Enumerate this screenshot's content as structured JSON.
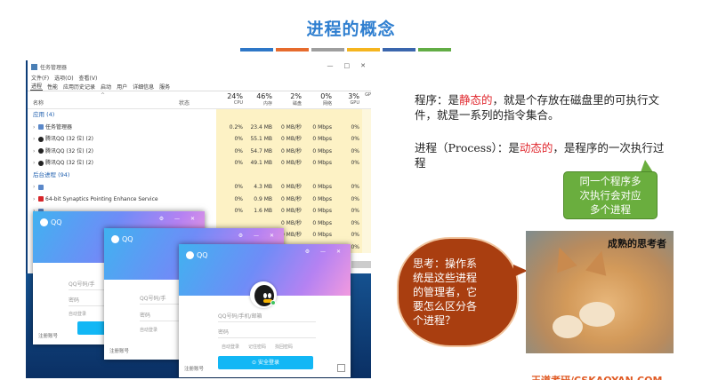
{
  "slide": {
    "title": "进程的概念",
    "colorbar": [
      "#2e77c7",
      "#e66b2d",
      "#9e9e9e",
      "#f5b51f",
      "#3a66ad",
      "#62ad45"
    ]
  },
  "task_manager": {
    "title": "任务管理器",
    "window_buttons": [
      "—",
      "□",
      "✕"
    ],
    "menu": [
      "文件(F)",
      "选项(O)",
      "查看(V)"
    ],
    "tabs": [
      "进程",
      "性能",
      "应用历史记录",
      "启动",
      "用户",
      "详细信息",
      "服务"
    ],
    "columns": {
      "name": "名称",
      "status": "状态",
      "metrics": [
        {
          "pct": "24%",
          "label": "CPU"
        },
        {
          "pct": "46%",
          "label": "内存"
        },
        {
          "pct": "2%",
          "label": "磁盘"
        },
        {
          "pct": "0%",
          "label": "网络"
        },
        {
          "pct": "3%",
          "label": "GPU"
        },
        {
          "pct": "",
          "label": "GP"
        }
      ]
    },
    "groups": {
      "apps": "应用 (4)",
      "background": "后台进程 (94)"
    },
    "app_rows": [
      {
        "name": "任务管理器",
        "icon": "task-manager-icon",
        "cpu": "0.2%",
        "mem": "23.4 MB",
        "disk": "0 MB/秒",
        "net": "0 Mbps",
        "gpu": "0%"
      },
      {
        "name": "腾讯QQ (32 位) (2)",
        "icon": "qq-penguin-icon",
        "cpu": "0%",
        "mem": "55.1 MB",
        "disk": "0 MB/秒",
        "net": "0 Mbps",
        "gpu": "0%"
      },
      {
        "name": "腾讯QQ (32 位) (2)",
        "icon": "qq-penguin-icon",
        "cpu": "0%",
        "mem": "54.7 MB",
        "disk": "0 MB/秒",
        "net": "0 Mbps",
        "gpu": "0%"
      },
      {
        "name": "腾讯QQ (32 位) (2)",
        "icon": "qq-penguin-icon",
        "cpu": "0%",
        "mem": "49.1 MB",
        "disk": "0 MB/秒",
        "net": "0 Mbps",
        "gpu": "0%"
      }
    ],
    "bg_rows": [
      {
        "name": "",
        "icon": "app-icon",
        "cpu": "0%",
        "mem": "4.3 MB",
        "disk": "0 MB/秒",
        "net": "0 Mbps",
        "gpu": "0%"
      },
      {
        "name": "64-bit Synaptics Pointing Enhance Service",
        "icon": "synaptics-icon",
        "cpu": "0%",
        "mem": "0.9 MB",
        "disk": "0 MB/秒",
        "net": "0 Mbps",
        "gpu": "0%"
      },
      {
        "name": "",
        "icon": "app-icon",
        "cpu": "0%",
        "mem": "1.6 MB",
        "disk": "0 MB/秒",
        "net": "0 Mbps",
        "gpu": "0%"
      },
      {
        "name": "",
        "icon": "",
        "cpu": "",
        "mem": "",
        "disk": "0 MB/秒",
        "net": "0 Mbps",
        "gpu": "0%"
      },
      {
        "name": "",
        "icon": "",
        "cpu": "",
        "mem": "",
        "disk": "0 MB/秒",
        "net": "0 Mbps",
        "gpu": "0%"
      },
      {
        "name": "",
        "icon": "",
        "cpu": "",
        "mem": "",
        "disk": "",
        "net": "0 Mbps",
        "gpu": "0%"
      }
    ]
  },
  "qq_windows": [
    {
      "logo": "QQ",
      "account_placeholder": "QQ号码/手",
      "password_placeholder": "密码",
      "auto_login": "自动登录",
      "register": "注册账号"
    },
    {
      "logo": "QQ",
      "account_placeholder": "QQ号码/手",
      "password_placeholder": "密码",
      "auto_login": "自动登录",
      "register": "注册账号"
    },
    {
      "logo": "QQ",
      "account_placeholder": "QQ号码/手机/邮箱",
      "password_placeholder": "密码",
      "auto_login": "自动登录",
      "remember": "记住密码",
      "find_password": "找回密码",
      "login_button": "⊙ 安全登录",
      "register": "注册账号"
    }
  ],
  "right": {
    "program_label": "程序：是",
    "program_hl": "静态的",
    "program_rest": "，就是个存放在磁盘里的可执行文件，就是一系列的指令集合。",
    "process_label": "进程（Process）：是",
    "process_hl": "动态的",
    "process_rest": "，是程序的一次执行过程",
    "green_callout": [
      "同一个程序多",
      "次执行会对应",
      "多个进程"
    ],
    "think_bubble": [
      "思考：操作系",
      "统是这些进程",
      "的管理者，它",
      "要怎么区分各",
      "个进程？"
    ],
    "photo_caption": "成熟的思考者",
    "footer_brand": "王道考研/CSKAOYAN.COM"
  }
}
